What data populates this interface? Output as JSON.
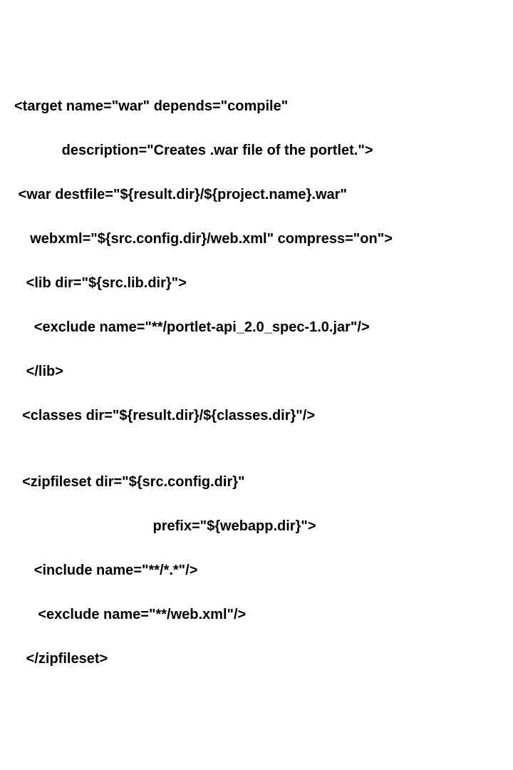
{
  "lines": [
    "<target name=\"war\" depends=\"compile\"",
    "            description=\"Creates .war file of the portlet.\">",
    " <war destfile=\"${result.dir}/${project.name}.war\"",
    "    webxml=\"${src.config.dir}/web.xml\" compress=\"on\">",
    "   <lib dir=\"${src.lib.dir}\">",
    "     <exclude name=\"**/portlet-api_2.0_spec-1.0.jar\"/>",
    "   </lib>",
    "  <classes dir=\"${result.dir}/${classes.dir}\"/>",
    "",
    "  <zipfileset dir=\"${src.config.dir}\"",
    "                                   prefix=\"${webapp.dir}\">",
    "     <include name=\"**/*.*\"/>",
    "      <exclude name=\"**/web.xml\"/>",
    "   </zipfileset>"
  ]
}
